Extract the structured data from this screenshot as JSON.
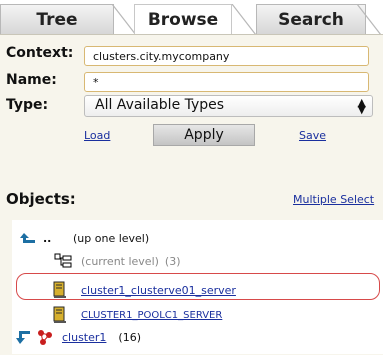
{
  "tabs": [
    {
      "label": "Tree",
      "active": false
    },
    {
      "label": "Browse",
      "active": true
    },
    {
      "label": "Search",
      "active": false
    }
  ],
  "form": {
    "context_label": "Context:",
    "context_value": "clusters.city.mycompany",
    "name_label": "Name:",
    "name_value": "*",
    "type_label": "Type:",
    "type_value": "All Available Types",
    "load_label": "Load",
    "apply_label": "Apply",
    "save_label": "Save"
  },
  "objects": {
    "heading": "Objects:",
    "multiple_select_label": "Multiple Select",
    "items": [
      {
        "marker": "..",
        "label": "(up one level)",
        "kind": "up-level"
      },
      {
        "label": "(current level)",
        "count": "(3)",
        "kind": "current-level"
      },
      {
        "label": "cluster1_clusterve01_server",
        "kind": "server",
        "selected": true
      },
      {
        "label": "CLUSTER1_POOLC1_SERVER",
        "kind": "server"
      },
      {
        "label": "cluster1",
        "count": "(16)",
        "kind": "cluster"
      }
    ]
  },
  "colors": {
    "link": "#1a2f9e",
    "highlight_border": "#d74a4a",
    "field_border": "#d8b873",
    "panel_bg": "#f7f5ec"
  }
}
